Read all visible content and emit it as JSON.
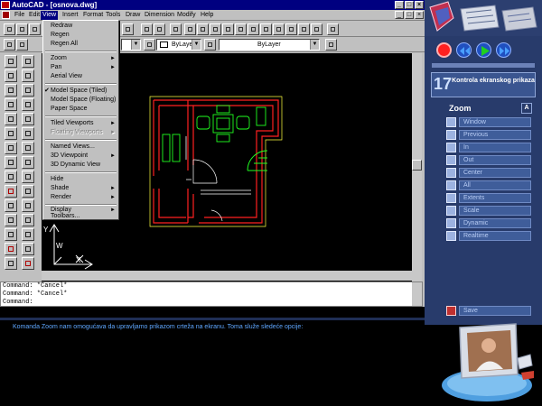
{
  "window": {
    "title": "AutoCAD - [osnova.dwg]",
    "min_label": "_",
    "max_label": "□",
    "close_label": "×"
  },
  "menubar": {
    "items": [
      "File",
      "Edit",
      "View",
      "Insert",
      "Format",
      "Tools",
      "Draw",
      "Dimension",
      "Modify",
      "Help"
    ],
    "active": "View"
  },
  "toolbar": {
    "layer_value": "0",
    "color_value": "ByLayer",
    "linetype_value": "ByLayer"
  },
  "view_menu": {
    "items": [
      {
        "label": "Redraw",
        "enabled": true,
        "submenu": false,
        "checked": false
      },
      {
        "label": "Regen",
        "enabled": true,
        "submenu": false,
        "checked": false
      },
      {
        "label": "Regen All",
        "enabled": true,
        "submenu": false,
        "checked": false
      },
      {
        "label": "Zoom",
        "enabled": true,
        "submenu": true,
        "checked": false
      },
      {
        "label": "Pan",
        "enabled": true,
        "submenu": true,
        "checked": false
      },
      {
        "label": "Aerial View",
        "enabled": true,
        "submenu": false,
        "checked": false
      },
      {
        "label": "Model Space (Tiled)",
        "enabled": true,
        "submenu": false,
        "checked": true
      },
      {
        "label": "Model Space (Floating)",
        "enabled": true,
        "submenu": false,
        "checked": false
      },
      {
        "label": "Paper Space",
        "enabled": true,
        "submenu": false,
        "checked": false
      },
      {
        "label": "Tiled Viewports",
        "enabled": true,
        "submenu": true,
        "checked": false
      },
      {
        "label": "Floating Viewports",
        "enabled": false,
        "submenu": true,
        "checked": false
      },
      {
        "label": "Named Views...",
        "enabled": true,
        "submenu": false,
        "checked": false
      },
      {
        "label": "3D Viewpoint",
        "enabled": true,
        "submenu": true,
        "checked": false
      },
      {
        "label": "3D Dynamic View",
        "enabled": true,
        "submenu": false,
        "checked": false
      },
      {
        "label": "Hide",
        "enabled": true,
        "submenu": false,
        "checked": false
      },
      {
        "label": "Shade",
        "enabled": true,
        "submenu": true,
        "checked": false
      },
      {
        "label": "Render",
        "enabled": true,
        "submenu": true,
        "checked": false
      },
      {
        "label": "Display",
        "enabled": true,
        "submenu": true,
        "checked": false
      },
      {
        "label": "Toolbars...",
        "enabled": true,
        "submenu": false,
        "checked": false
      }
    ]
  },
  "command_line": {
    "lines": [
      "Command: *Cancel*",
      "Command: *Cancel*",
      "Command:"
    ]
  },
  "ucs_labels": {
    "y": "Y",
    "x": "X",
    "w": "W"
  },
  "tutorial": {
    "lesson_number": "17",
    "lesson_title": "Kontrola ekranskog prikaza",
    "section": "Zoom",
    "help_label": "A",
    "zoom_options": [
      "Window",
      "Previous",
      "In",
      "Out",
      "Center",
      "All",
      "Extents",
      "Scale",
      "Dynamic",
      "Realtime"
    ],
    "save_label": "Save",
    "narration": "Komanda Zoom nam omogućava da upravljamo prikazom crteža na ekranu. Toma služe sledeće opcije:"
  },
  "colors": {
    "title_bar": "#000080",
    "panel_bg": "#283b6b",
    "record_button": "#ff2020",
    "play_button": "#20d020",
    "nav_button": "#4aa0ff",
    "narration_text": "#5fa7ff",
    "drawing_wall": "#ff2020",
    "drawing_furniture": "#20ff20",
    "drawing_outline": "#ffff40"
  }
}
